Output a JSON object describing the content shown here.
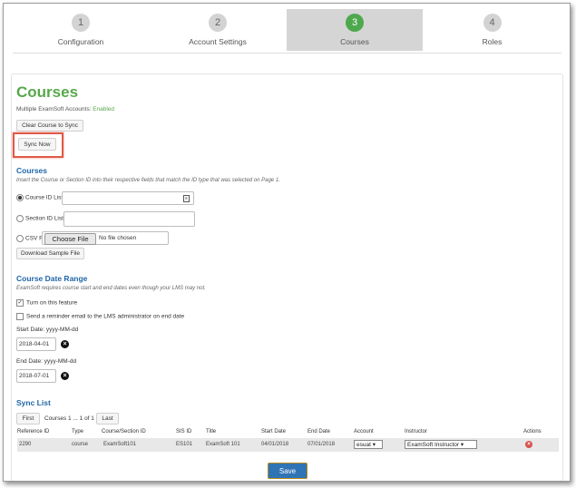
{
  "steps": [
    {
      "number": "1",
      "label": "Configuration"
    },
    {
      "number": "2",
      "label": "Account Settings"
    },
    {
      "number": "3",
      "label": "Courses"
    },
    {
      "number": "4",
      "label": "Roles"
    }
  ],
  "page": {
    "title": "Courses",
    "multi_accounts_label": "Multiple ExamSoft Accounts:",
    "multi_accounts_value": "Enabled",
    "clear_button": "Clear Course to Sync",
    "sync_button": "Sync Now"
  },
  "courses_section": {
    "heading": "Courses",
    "hint": "Insert the Course or Section ID into their respective fields that match the ID type that was selected on Page 1.",
    "course_id_label": "Course ID List",
    "section_id_label": "Section ID List",
    "csv_label": "CSV File",
    "choose_file": "Choose File",
    "no_file": "No file chosen",
    "download_button": "Download Sample File"
  },
  "date_section": {
    "heading": "Course Date Range",
    "hint": "ExamSoft requires course start and end dates even though your LMS may not.",
    "turn_on": "Turn on this feature",
    "reminder": "Send a reminder email to the LMS administrator on end date",
    "start_label": "Start Date: yyyy-MM-dd",
    "start_value": "2018-04-01",
    "end_label": "End Date: yyyy-MM-dd",
    "end_value": "2018-07-01"
  },
  "sync_list": {
    "heading": "Sync List",
    "first": "First",
    "courses_count": "Courses 1 ... 1 of 1",
    "last": "Last",
    "columns": [
      "Reference ID",
      "Type",
      "Course/Section ID",
      "SIS ID",
      "Title",
      "Start Date",
      "End Date",
      "Account",
      "Instructor",
      "Actions"
    ],
    "rows": [
      {
        "ref": "2290",
        "type": "course",
        "course_id": "ExamSoft101",
        "sis": "ES101",
        "title": "ExamSoft 101",
        "start": "04/01/2018",
        "end": "07/01/2018",
        "account": "esuat",
        "instructor": "ExamSoft Instructor"
      }
    ]
  },
  "save_button": "Save",
  "colors": {
    "accent_green": "#57a84a",
    "heading_blue": "#1f66a8",
    "save_blue": "#2f74b5",
    "highlight_red": "#e05a47"
  }
}
